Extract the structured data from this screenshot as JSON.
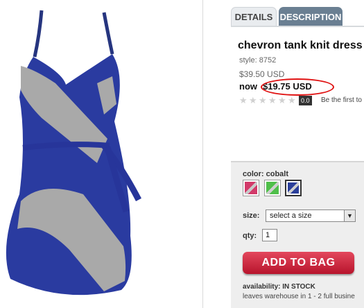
{
  "product": {
    "image_alt": "cobalt chevron tank knit dress",
    "tabs": [
      "DETAILS",
      "DESCRIPTION"
    ],
    "title": "chevron tank knit dress",
    "style": "style: 8752",
    "old_price": "$39.50 USD",
    "now_label": "now",
    "sale_price": "$19.75 USD",
    "rating_value": "0.0",
    "rating_text": "Be the first to"
  },
  "options": {
    "color_label": "color: cobalt",
    "swatches": [
      "pink-swatch",
      "green-swatch",
      "cobalt-swatch"
    ],
    "size_label": "size:",
    "size_value": "select a size",
    "qty_label": "qty:",
    "qty_value": "1",
    "add_button": "ADD TO BAG",
    "availability": "availability: IN STOCK",
    "warehouse": "leaves warehouse in 1 - 2 full busine"
  },
  "colors": {
    "accent_red": "#c81e32",
    "tab_active": "#6a7f92",
    "dress_blue": "#253b9c",
    "dress_gray": "#a8a8a8"
  }
}
